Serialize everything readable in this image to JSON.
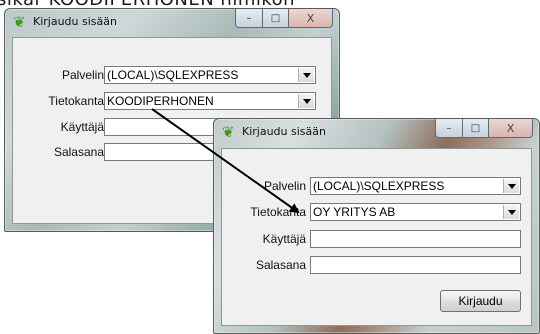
{
  "caption": "sikar KOODIPERHONEN nimikon",
  "window_title": "Kirjaudu sisään",
  "windows": [
    {
      "server_label": "Palvelin",
      "server_value": "(LOCAL)\\SQLEXPRESS",
      "database_label": "Tietokanta",
      "database_value": "KOODIPERHONEN",
      "user_label": "Käyttäjä",
      "user_value": "",
      "password_label": "Salasana",
      "password_value": ""
    },
    {
      "server_label": "Palvelin",
      "server_value": "(LOCAL)\\SQLEXPRESS",
      "database_label": "Tietokanta",
      "database_value": "OY YRITYS AB",
      "user_label": "Käyttäjä",
      "user_value": "",
      "password_label": "Salasana",
      "password_value": "",
      "login_button": "Kirjaudu"
    }
  ],
  "title_controls": {
    "minimize": "–",
    "maximize": "□",
    "close": "X"
  },
  "icons": {
    "window_icon": "green-leaf-icon",
    "dropdown_icon": "chevron-down-icon"
  }
}
